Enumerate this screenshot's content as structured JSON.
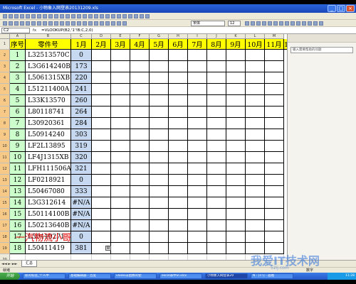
{
  "window": {
    "title": "Microsoft Excel - 小物象入网登表20131209.xls"
  },
  "toolbar": {
    "font_name": "宋体",
    "font_size": "12"
  },
  "formula_bar": {
    "name_box": "C2",
    "fx": "fx",
    "formula": "=VLOOKUP(B2,'1'!B:C,2,0)"
  },
  "task_pane": {
    "search_placeholder": "输入需要帮助的问题"
  },
  "columns": [
    "A",
    "B",
    "C",
    "D",
    "E",
    "F",
    "G",
    "H",
    "I",
    "J",
    "K",
    "L",
    "M"
  ],
  "header": {
    "seq": "序号",
    "part": "零件号",
    "months": [
      "1月",
      "2月",
      "3月",
      "4月",
      "5月",
      "6月",
      "7月",
      "8月",
      "9月",
      "10月",
      "11月",
      "12月"
    ]
  },
  "rows": [
    {
      "seq": "1",
      "part": "L32513570C",
      "jan": "0"
    },
    {
      "seq": "2",
      "part": "L3G614240B",
      "jan": "173"
    },
    {
      "seq": "3",
      "part": "L5061315XB",
      "jan": "220"
    },
    {
      "seq": "4",
      "part": "L51211400A",
      "jan": "241"
    },
    {
      "seq": "5",
      "part": "L33K13570",
      "jan": "260"
    },
    {
      "seq": "6",
      "part": "L80118741",
      "jan": "264"
    },
    {
      "seq": "7",
      "part": "L30920361",
      "jan": "284"
    },
    {
      "seq": "8",
      "part": "L50914240",
      "jan": "303"
    },
    {
      "seq": "9",
      "part": "LF2L13895",
      "jan": "319"
    },
    {
      "seq": "10",
      "part": "LF4J1315XB",
      "jan": "320"
    },
    {
      "seq": "11",
      "part": "LFH111506A",
      "jan": "321"
    },
    {
      "seq": "12",
      "part": "LF0218921",
      "jan": "0"
    },
    {
      "seq": "13",
      "part": "L50467080",
      "jan": "333"
    },
    {
      "seq": "14",
      "part": "L3G312614",
      "jan": "#N/A"
    },
    {
      "seq": "15",
      "part": "L50114100B",
      "jan": "#N/A"
    },
    {
      "seq": "16",
      "part": "L50213640B",
      "jan": "#N/A"
    },
    {
      "seq": "17",
      "part": "L50410271",
      "jan": "0"
    },
    {
      "seq": "18",
      "part": "L50411419",
      "jan": "381"
    }
  ],
  "row_numbers": [
    "1",
    "2",
    "3",
    "4",
    "5",
    "6",
    "7",
    "8",
    "9",
    "10",
    "11",
    "12",
    "13",
    "14",
    "15",
    "16",
    "17",
    "18",
    "19",
    "20",
    "21"
  ],
  "watermark": "一汽物流小哥",
  "sheet": {
    "tab": "汇总"
  },
  "status": {
    "left": "就绪",
    "num": "数字"
  },
  "taskbar": {
    "start": "开始",
    "items": [
      "新的标签_个人中",
      "基础编辑器 - 百度",
      "vlookup函数的使",
      "excel表中vl.xlsx",
      "小物象入网登表20",
      "N - [F:\\] - 画图"
    ],
    "clock": "11:28"
  },
  "logo": {
    "main": "我爱IT技术网",
    "sub": "52ij.com"
  }
}
